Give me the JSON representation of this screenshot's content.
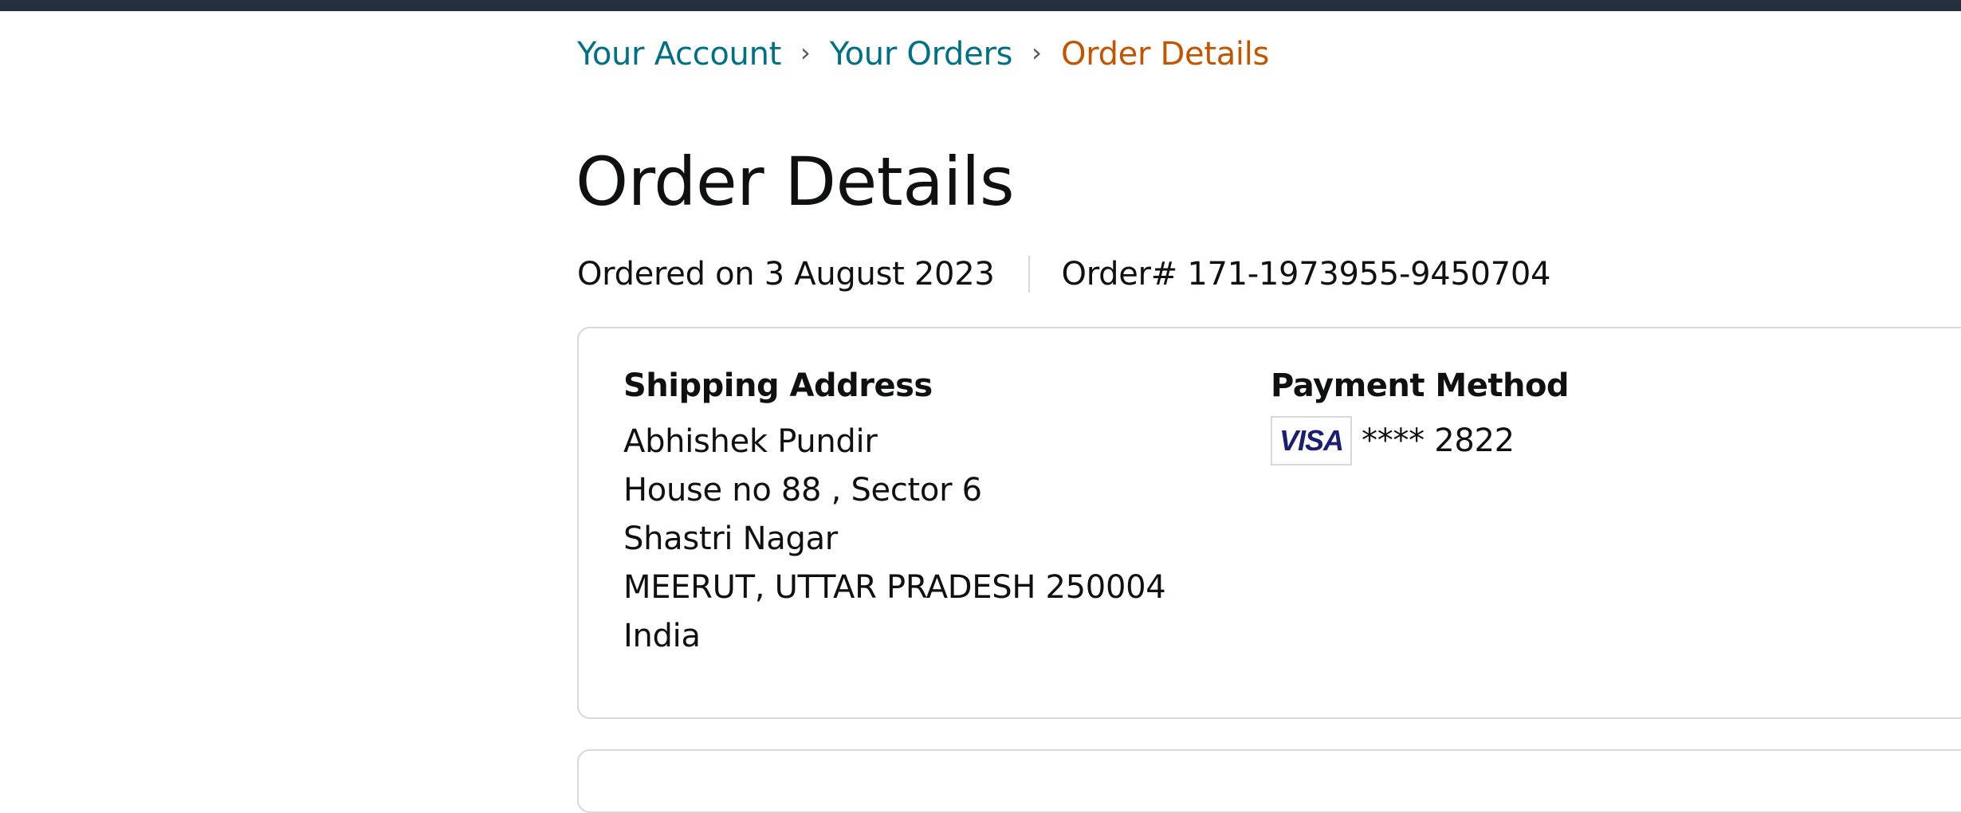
{
  "breadcrumb": {
    "items": [
      {
        "label": "Your Account"
      },
      {
        "label": "Your Orders"
      },
      {
        "label": "Order Details"
      }
    ],
    "separator": "›"
  },
  "page": {
    "title": "Order Details",
    "ordered_on": "Ordered on 3 August 2023",
    "order_number": "Order# 171-1973955-9450704"
  },
  "shipping": {
    "heading": "Shipping Address",
    "lines": [
      "Abhishek Pundir",
      "House no 88 , Sector 6",
      "Shastri Nagar",
      "MEERUT, UTTAR PRADESH 250004",
      "India"
    ]
  },
  "payment": {
    "heading": "Payment Method",
    "card_brand": "VISA",
    "card_number": "**** 2822"
  },
  "colors": {
    "header_bar": "#232f3e",
    "link": "#007185",
    "current_crumb": "#c45500",
    "border": "#d5d9d9",
    "visa_blue": "#1a1f71"
  },
  "icons": {
    "card_brand_icon": "visa-card-icon"
  }
}
